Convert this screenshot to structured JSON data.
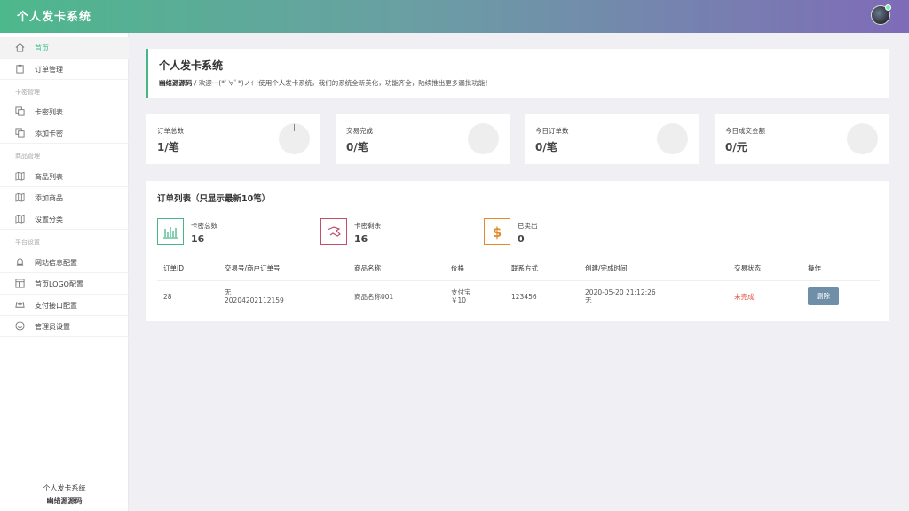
{
  "header": {
    "title": "个人发卡系统"
  },
  "sidebar": {
    "items": [
      {
        "label": "首页",
        "icon": "home-icon"
      },
      {
        "label": "订单管理",
        "icon": "clipboard-icon"
      },
      {
        "label": "卡密列表",
        "icon": "copy-icon"
      },
      {
        "label": "添加卡密",
        "icon": "copy-icon"
      },
      {
        "label": "商品列表",
        "icon": "map-icon"
      },
      {
        "label": "添加商品",
        "icon": "map-icon"
      },
      {
        "label": "设置分类",
        "icon": "map-icon"
      },
      {
        "label": "网站信息配置",
        "icon": "bell-icon"
      },
      {
        "label": "首页LOGO配置",
        "icon": "layout-icon"
      },
      {
        "label": "支付接口配置",
        "icon": "crown-icon"
      },
      {
        "label": "管理员设置",
        "icon": "smile-icon"
      }
    ],
    "sections": [
      "卡密管理",
      "商品管理",
      "平台设置"
    ],
    "footer_line1": "个人发卡系统",
    "footer_line2": "幽络源源码"
  },
  "page": {
    "title": "个人发卡系统",
    "breadcrumb_site": "幽络源源码",
    "breadcrumb_sep": "/",
    "welcome": "欢迎一(*ﾟ∀ﾟ*)ノｲ !使用个人发卡系统，我们的系统全新美化，功能齐全，陆续推出更多漏批功能！"
  },
  "stats": [
    {
      "label": "订单总数",
      "value": "1/笔"
    },
    {
      "label": "交易完成",
      "value": "0/笔"
    },
    {
      "label": "今日订单数",
      "value": "0/笔"
    },
    {
      "label": "今日成交金额",
      "value": "0/元"
    }
  ],
  "orders": {
    "title": "订单列表（只显示最新10笔）",
    "summary": [
      {
        "label": "卡密总数",
        "value": "16",
        "icon": "bar-chart-icon",
        "color": "#45b787"
      },
      {
        "label": "卡密剩余",
        "value": "16",
        "icon": "hand-icon",
        "color": "#c0506a"
      },
      {
        "label": "已卖出",
        "value": "0",
        "icon": "dollar-icon",
        "color": "#e08a2a"
      }
    ],
    "columns": [
      "订单ID",
      "交易号/商户订单号",
      "商品名称",
      "价格",
      "联系方式",
      "创建/完成时间",
      "交易状态",
      "操作"
    ],
    "rows": [
      {
        "id": "28",
        "trade_no": "无",
        "merchant_no": "20204202112159",
        "product": "商品名称001",
        "pay_method": "支付宝",
        "price": "￥10",
        "contact": "123456",
        "created": "2020-05-20 21:12:26",
        "finished": "无",
        "status": "未完成",
        "action": "删除"
      }
    ]
  },
  "colors": {
    "accent": "#45b787",
    "danger": "#e0513a",
    "button": "#6f8fa8"
  }
}
